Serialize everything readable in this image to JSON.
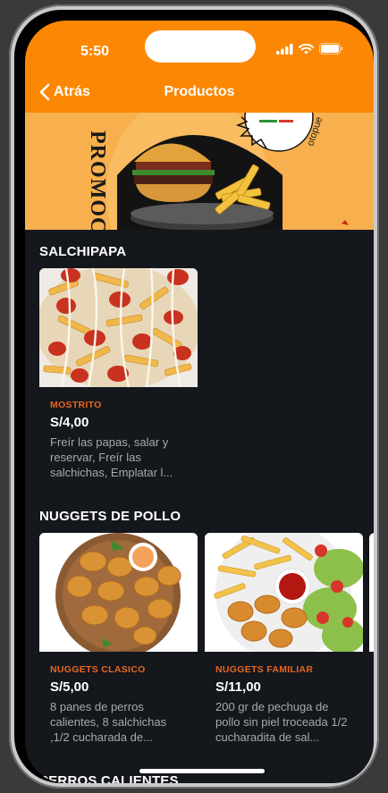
{
  "status_bar": {
    "time": "5:50"
  },
  "header": {
    "back_label": "Atrás",
    "title": "Productos"
  },
  "banner": {
    "promo_text": "PROMOCI",
    "side_text": "otopue"
  },
  "sections": [
    {
      "title": "SALCHIPAPA",
      "products": [
        {
          "name": "MOSTRITO",
          "price": "S/4,00",
          "description": "Freír las papas, salar y reservar, Freír las salchichas, Emplatar l..."
        }
      ]
    },
    {
      "title": "NUGGETS DE POLLO",
      "products": [
        {
          "name": "NUGGETS CLASICO",
          "price": "S/5,00",
          "description": "8 panes de perros calientes, 8 salchichas ,1/2 cucharada de..."
        },
        {
          "name": "NUGGETS FAMILIAR",
          "price": "S/11,00",
          "description": "200 gr de pechuga de pollo sin piel troceada 1/2 cucharadita de sal..."
        }
      ]
    },
    {
      "title": "PERROS CALIENTES",
      "products": []
    }
  ],
  "colors": {
    "accent": "#fb8704",
    "product_name": "#e8661f",
    "background": "#14171c",
    "banner": "#f8b04e"
  }
}
